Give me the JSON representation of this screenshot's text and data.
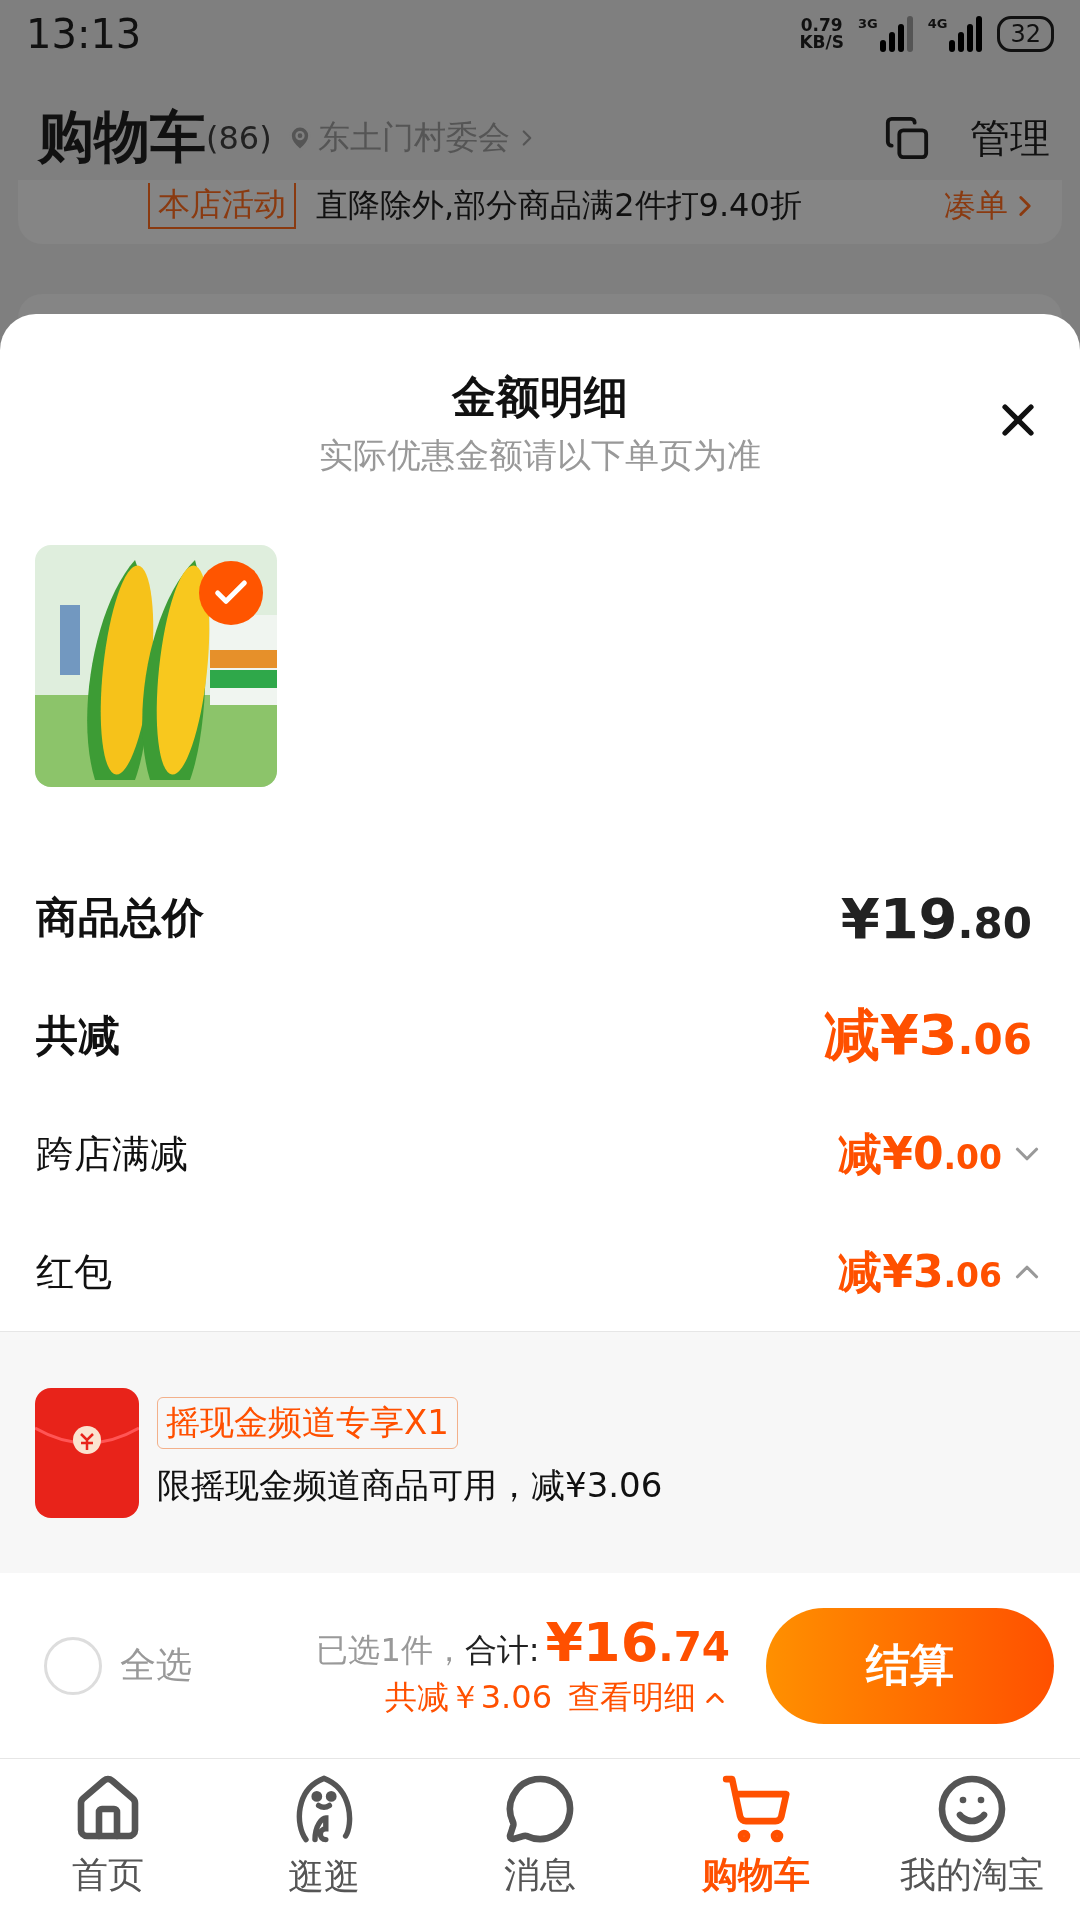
{
  "status_bar": {
    "time": "13:13",
    "speed": "0.79",
    "speed_unit": "KB/S",
    "sim1": "3G",
    "sim2": "4G",
    "battery": "32"
  },
  "header": {
    "title": "购物车",
    "count": "(86)",
    "location": "东土门村委会",
    "manage": "管理"
  },
  "promo": {
    "tag": "本店活动",
    "text": "直降除外,部分商品满2件打9.40折",
    "link": "凑单"
  },
  "sheet": {
    "title": "金额明细",
    "subtitle": "实际优惠金额请以下单页为准",
    "products": [
      {
        "kind": "picture",
        "selected": true
      }
    ],
    "rows": [
      {
        "kind": "total",
        "label": "商品总价",
        "amount": "¥19.80"
      },
      {
        "kind": "discount",
        "label": "共减",
        "amount": "减¥3.06"
      },
      {
        "kind": "item",
        "label": "跨店满减",
        "amount": "减¥0.00",
        "expanded": false
      },
      {
        "kind": "item",
        "label": "红包",
        "amount": "减¥3.06",
        "expanded": true
      }
    ],
    "coupons": [
      {
        "tag": "摇现金频道专享X1",
        "text": "限摇现金频道商品可用，减¥3.06"
      }
    ]
  },
  "checkout": {
    "select_all": {
      "label": "全选",
      "checked": false
    },
    "selected": "已选1件，",
    "total_label": "合计:",
    "total": "¥16.74",
    "saving": "共减￥3.06",
    "details": "查看明细",
    "details_expanded": true,
    "button": "结算"
  },
  "tab_bar": [
    {
      "kind": "home",
      "label": "首页",
      "selected": false
    },
    {
      "kind": "stroll",
      "label": "逛逛",
      "selected": false
    },
    {
      "kind": "message",
      "label": "消息",
      "selected": false
    },
    {
      "kind": "cart",
      "label": "购物车",
      "selected": true
    },
    {
      "kind": "profile",
      "label": "我的淘宝",
      "selected": false
    }
  ]
}
